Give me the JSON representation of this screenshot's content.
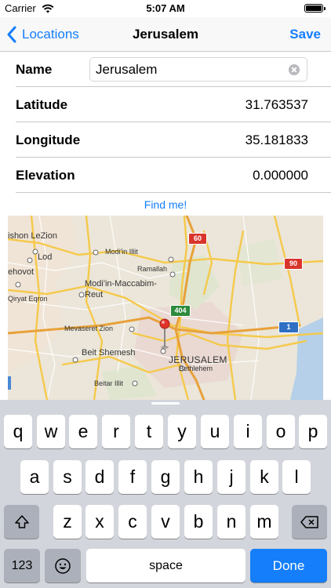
{
  "status": {
    "carrier": "Carrier",
    "time": "5:07 AM"
  },
  "navbar": {
    "back_label": "Locations",
    "title": "Jerusalem",
    "save_label": "Save"
  },
  "form": {
    "name": {
      "label": "Name",
      "value": "Jerusalem"
    },
    "latitude": {
      "label": "Latitude",
      "value": "31.763537"
    },
    "longitude": {
      "label": "Longitude",
      "value": "35.181833"
    },
    "elevation": {
      "label": "Elevation",
      "value": "0.000000"
    }
  },
  "find_me_label": "Find me!",
  "map": {
    "places": [
      "ishon LeZion",
      "Lod",
      "ehovot",
      "Qiryat Eqron",
      "Modi'in Illit",
      "Ramallah",
      "Modi'in-Maccabim-Reut",
      "Mevaseret Zion",
      "Beit Shemesh",
      "JERUSALEM",
      "Bethlehem",
      "Beitar Illit"
    ],
    "route_shields": [
      "60",
      "90",
      "404",
      "1"
    ]
  },
  "keyboard": {
    "row1": [
      "q",
      "w",
      "e",
      "r",
      "t",
      "y",
      "u",
      "i",
      "o",
      "p"
    ],
    "row2": [
      "a",
      "s",
      "d",
      "f",
      "g",
      "h",
      "j",
      "k",
      "l"
    ],
    "row3": [
      "z",
      "x",
      "c",
      "v",
      "b",
      "n",
      "m"
    ],
    "numbers_label": "123",
    "space_label": "space",
    "done_label": "Done"
  }
}
